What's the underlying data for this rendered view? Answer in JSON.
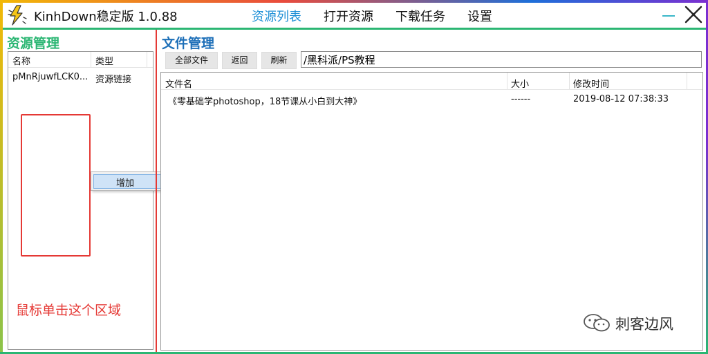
{
  "window": {
    "title": "KinhDown稳定版 1.0.88",
    "nav": [
      "资源列表",
      "打开资源",
      "下载任务",
      "设置"
    ],
    "active_nav": 0,
    "colors": {
      "accent": "#1e8fd6",
      "green": "#2bb673",
      "red": "#e53935",
      "blue_title": "#1d6fb8"
    }
  },
  "left": {
    "title": "资源管理",
    "columns": [
      "名称",
      "类型"
    ],
    "rows": [
      {
        "name": "pMnRjuwfLCK0...",
        "type": "资源链接"
      }
    ],
    "context_menu": {
      "item": "增加"
    },
    "hint": "鼠标单击这个区域"
  },
  "right": {
    "title": "文件管理",
    "buttons": [
      "全部文件",
      "返回",
      "刷新"
    ],
    "path": "/黑科派/PS教程",
    "columns": [
      "文件名",
      "大小",
      "修改时间"
    ],
    "rows": [
      {
        "name": "《零基础学photoshop，18节课从小白到大神》",
        "size": "------",
        "mtime": "2019-08-12 07:38:33"
      }
    ]
  },
  "watermark": {
    "text": "刺客边风",
    "icon": "wechat-icon"
  }
}
